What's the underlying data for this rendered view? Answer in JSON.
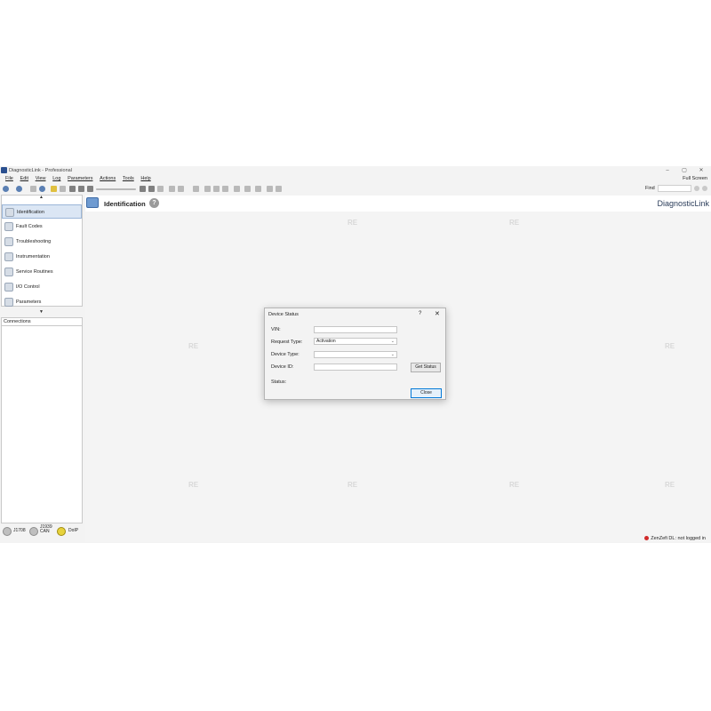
{
  "window": {
    "title": "DiagnosticLink - Professional",
    "minimize": "–",
    "maximize": "▢",
    "close": "✕"
  },
  "menu": [
    "File",
    "Edit",
    "View",
    "Log",
    "Parameters",
    "Actions",
    "Tools",
    "Help"
  ],
  "full_screen": "Full Screen",
  "find": {
    "label": "Find",
    "value": ""
  },
  "nav": {
    "items": [
      {
        "label": "Identification",
        "icon": "identification-icon"
      },
      {
        "label": "Fault Codes",
        "icon": "fault-codes-icon"
      },
      {
        "label": "Troubleshooting",
        "icon": "troubleshooting-icon"
      },
      {
        "label": "Instrumentation",
        "icon": "instrumentation-icon"
      },
      {
        "label": "Service Routines",
        "icon": "service-routines-icon"
      },
      {
        "label": "I/O Control",
        "icon": "io-control-icon"
      },
      {
        "label": "Parameters",
        "icon": "parameters-icon"
      }
    ],
    "selected": "Identification"
  },
  "connections": {
    "title": "Connections"
  },
  "adapters": [
    {
      "label": "J1708",
      "color": "#bfbfbf"
    },
    {
      "label": "J1939 CAN",
      "color": "#bfbfbf"
    },
    {
      "label": "DoIP",
      "color": "#e7d23c"
    }
  ],
  "header": {
    "title": "Identification",
    "brand": "DiagnosticLink"
  },
  "watermark": "RE",
  "status": {
    "text": "ZenZefi DL: not logged in",
    "color": "#d12b2b"
  },
  "dialog": {
    "title": "Device Status",
    "help": "?",
    "close": "✕",
    "fields": {
      "vin_label": "VIN:",
      "vin_value": "",
      "request_type_label": "Request Type:",
      "request_type_value": "Activation",
      "device_type_label": "Device Type:",
      "device_type_value": "",
      "device_id_label": "Device ID:",
      "device_id_value": "",
      "status_label": "Status:"
    },
    "get_status_button": "Get Status",
    "close_button": "Close"
  }
}
